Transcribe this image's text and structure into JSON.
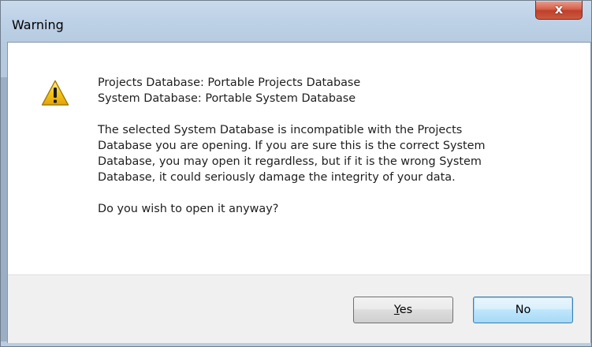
{
  "window": {
    "title": "Warning",
    "close_glyph": "x"
  },
  "message": {
    "icon": "warning-icon",
    "line1": "Projects Database: Portable Projects Database",
    "line2": "System Database: Portable System Database",
    "body_lines": [
      "The selected System Database is incompatible with the Projects",
      "Database you are opening. If you are sure this is the correct System",
      "Database, you may open it regardless, but if it is the wrong System",
      "Database, it could seriously damage the integrity of your data."
    ],
    "question": "Do you wish to open it anyway?"
  },
  "buttons": {
    "yes_mnemonic": "Y",
    "yes_rest": "es",
    "no_label": "No"
  },
  "colors": {
    "warning_yellow": "#f5c61b",
    "close_red": "#c9452f",
    "default_button_blue": "#3c7fb1"
  }
}
